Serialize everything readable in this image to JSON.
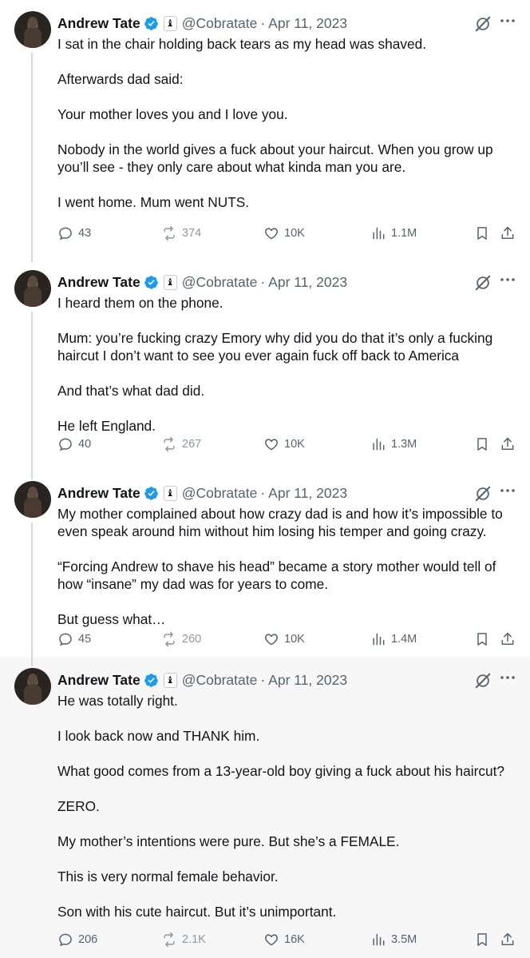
{
  "author": {
    "name": "Andrew Tate",
    "badge_glyph": "♝",
    "handle": "@Cobratate",
    "separator": "·",
    "date": "Apr 11, 2023"
  },
  "colors": {
    "verified": "#1d9bf0",
    "text": "#0f1419",
    "muted": "#536471",
    "thread_line": "#cfd9de",
    "highlight_bg": "#f7f7f7"
  },
  "icons": {
    "verified": "verified-badge-icon",
    "grok": "grok-icon",
    "more": "more-icon",
    "reply": "reply-icon",
    "repost": "repost-icon",
    "like": "like-icon",
    "views": "views-icon",
    "bookmark": "bookmark-icon",
    "share": "share-icon"
  },
  "tweets": [
    {
      "paragraphs": [
        "I sat in the chair holding back tears as my head was shaved.",
        "Afterwards dad said:",
        "Your mother loves you and I love you.",
        "Nobody in the world gives a fuck about your haircut. When you grow up you’ll see - they only care about what kinda man you are.",
        "I went home. Mum went NUTS."
      ],
      "stats": {
        "replies": "43",
        "reposts": "374",
        "likes": "10K",
        "views": "1.1M"
      }
    },
    {
      "paragraphs": [
        "I heard them on the phone.",
        "Mum: you’re fucking crazy Emory why did you do that it’s only a fucking haircut I don’t want to see you ever again fuck off back to America",
        "And that’s what dad did.",
        "He left England."
      ],
      "stats": {
        "replies": "40",
        "reposts": "267",
        "likes": "10K",
        "views": "1.3M"
      }
    },
    {
      "paragraphs": [
        "My mother complained about how crazy dad is and how it’s impossible to even speak around him without him losing his temper and going crazy.",
        "“Forcing Andrew to shave his head” became a story mother would tell of how “insane” my dad was for years to come.",
        "But guess what…"
      ],
      "stats": {
        "replies": "45",
        "reposts": "260",
        "likes": "10K",
        "views": "1.4M"
      }
    },
    {
      "paragraphs": [
        "He was totally right.",
        "I look back now and THANK him.",
        "What good comes from a 13-year-old boy giving a fuck about his haircut?",
        "ZERO.",
        "My mother’s intentions were pure. But she’s a FEMALE.",
        "This is very normal female behavior.",
        "Son with his cute haircut. But it’s unimportant."
      ],
      "stats": {
        "replies": "206",
        "reposts": "2.1K",
        "likes": "16K",
        "views": "3.5M"
      }
    }
  ]
}
